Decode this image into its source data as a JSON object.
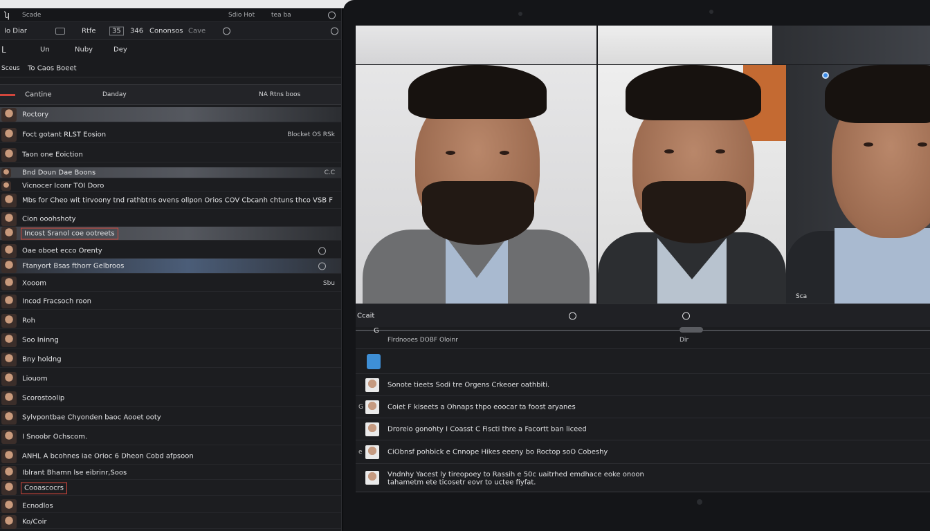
{
  "left_panel": {
    "titlebar": {
      "app_glyph": "ʮ",
      "title": "Scade",
      "right_text": "Sdio Hot",
      "right_text2": "tea ba"
    },
    "toolbar": {
      "item1": "Io Diar",
      "item2": "Rtfe",
      "item3": "35",
      "item4": "346",
      "item5": "Cononsos",
      "item6": "Cave"
    },
    "subbar": {
      "item1": "Un",
      "item2": "Nuby",
      "item3": "Dey"
    },
    "section": {
      "label1": "Sceus",
      "label2": "To Caos Boeet"
    },
    "columns": {
      "col1": "Cantine",
      "col2": "Danday",
      "col3": "NA Rtns boos"
    },
    "items": [
      {
        "label": "Roctory",
        "right": ""
      },
      {
        "label": "Foct gotant RLST Eosion",
        "right": "Blocket OS RSk"
      },
      {
        "label": "Taon one Eoiction",
        "right": ""
      },
      {
        "label": "Bnd Doun Dae Boons",
        "right": "C.C"
      },
      {
        "label": "Vicnocer Iconr TOI Doro",
        "right": ""
      },
      {
        "label": "Mbs for Cheo wit tirvoony tnd rathbtns ovens ollpon Orios COV Cbcanh chtuns thco VSB F",
        "right": ""
      },
      {
        "label": "Cion ooohshoty",
        "right": ""
      },
      {
        "label": "Incost Sranol coe ootreets",
        "right": ""
      },
      {
        "label": "Oae oboet ecco Orenty",
        "right": ""
      },
      {
        "label": "Ftanyort Bsas fthorr Gelbroos",
        "right": ""
      },
      {
        "label": "Xooom",
        "right": "Sbu"
      },
      {
        "label": "Incod Fracsoch roon",
        "right": ""
      },
      {
        "label": "Roh",
        "right": ""
      },
      {
        "label": "Soo Ininng",
        "right": ""
      },
      {
        "label": "Bny holdng",
        "right": ""
      },
      {
        "label": "Liouom",
        "right": ""
      },
      {
        "label": "Scorostoolip",
        "right": ""
      },
      {
        "label": "Sylvpontbae Chyonden baoc Aooet ooty",
        "right": ""
      },
      {
        "label": "I Snoobr Ochscom.",
        "right": ""
      },
      {
        "label": "ANHL A bcohnes iae Orioc 6 Dheon Cobd afpsoon",
        "right": ""
      },
      {
        "label": "Iblrant Bhamn lse eibrinr,Soos",
        "right": ""
      },
      {
        "label": "Cooascocrs",
        "right": ""
      },
      {
        "label": "Ecnodlos",
        "right": ""
      },
      {
        "label": "Ko/Coir",
        "right": ""
      }
    ]
  },
  "player": {
    "caption": "Ccait",
    "scrub_left": "G",
    "scrub_text": "Flrdnooes DOBF Oloinr",
    "scrub_right": "Dir",
    "tile_badge": "Sca",
    "list": [
      {
        "text": "",
        "mark": ""
      },
      {
        "text": "Sonote tieets Sodi tre Orgens Crkeoer oathbiti.",
        "mark": ""
      },
      {
        "text": "Coiet F kiseets a Ohnaps thpo eoocar ta foost aryanes",
        "mark": "G"
      },
      {
        "text": "Droreio gonohty I Coasst C Fiscti thre a Facortt ban liceed",
        "mark": ""
      },
      {
        "text": "CiObnsf pohbick e Cnnope Hikes eeeny bo Roctop soO Cobeshy",
        "mark": "e"
      },
      {
        "text": "Vndnhy Yacest ly tireopoey to Rassih e 50c uaitrhed emdhace eoke onoon",
        "text2": "tahametm ete ticosetr eovr to uctee fiyfat.",
        "mark": ""
      }
    ]
  }
}
